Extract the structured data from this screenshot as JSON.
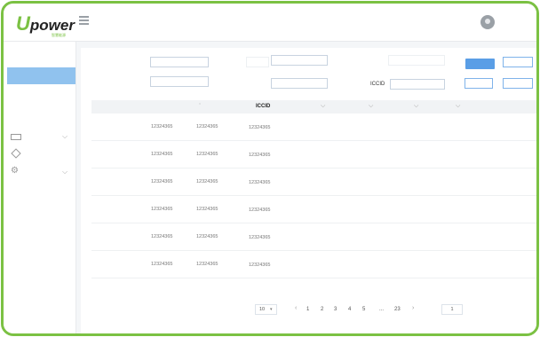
{
  "brand": {
    "logo_u": "U",
    "logo_rest": "power",
    "logo_tagline": "智慧能源"
  },
  "table": {
    "iccid_header": "ICCID",
    "rows": [
      [
        "12324365",
        "12324365",
        "12324365"
      ],
      [
        "12324365",
        "12324365",
        "12324365"
      ],
      [
        "12324365",
        "12324365",
        "12324365"
      ],
      [
        "12324365",
        "12324365",
        "12324365"
      ],
      [
        "12324365",
        "12324365",
        "12324365"
      ],
      [
        "12324365",
        "12324365",
        "12324365"
      ]
    ]
  },
  "filters": {
    "iccid_label": "ICCID"
  },
  "pagination": {
    "page_size": "10",
    "pages": [
      "1",
      "2",
      "3",
      "4",
      "5",
      "...",
      "23"
    ],
    "prev": "‹",
    "next": "›",
    "jump_value": "1"
  },
  "colors": {
    "accent": "#7bc143",
    "primary": "#5a9ee6"
  }
}
